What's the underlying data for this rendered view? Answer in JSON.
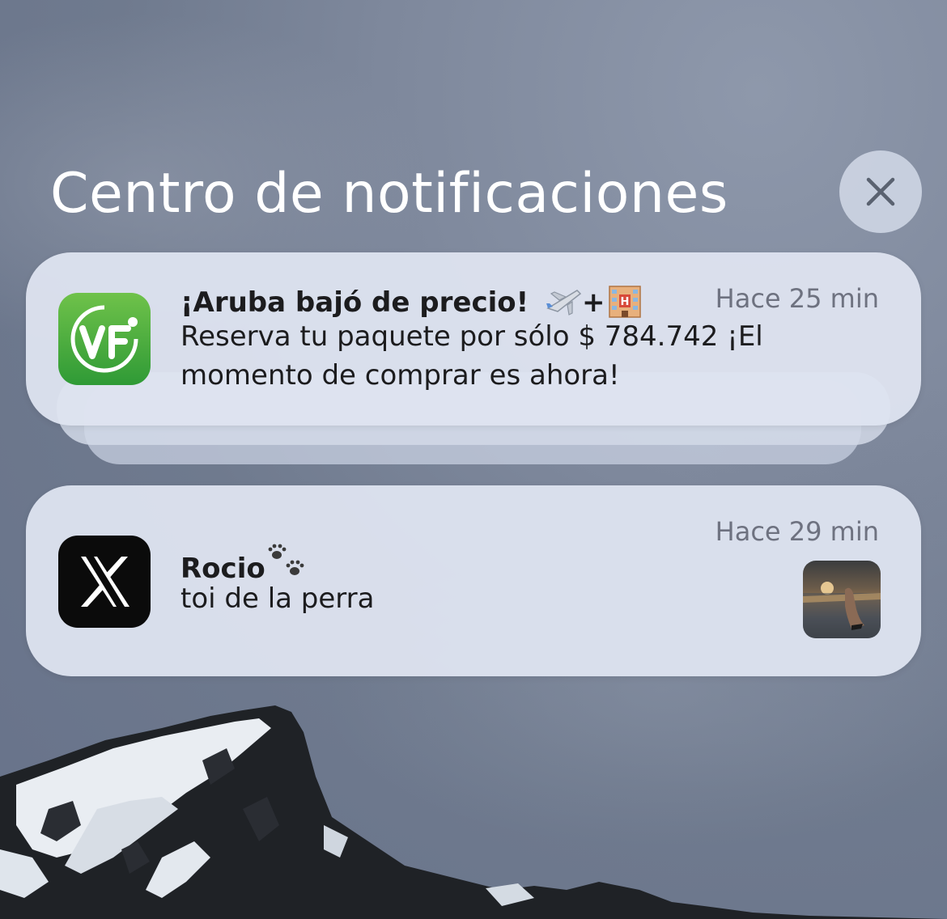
{
  "header": {
    "title": "Centro de notificaciones",
    "close_icon": "close-icon"
  },
  "notifications": [
    {
      "app_icon": "vf-app-icon",
      "app_icon_text": "VF",
      "title": "¡Aruba bajó de precio!",
      "title_emojis": [
        "airplane-emoji",
        "plus",
        "hotel-emoji"
      ],
      "plus_text": "+",
      "time": "Hace 25 min",
      "body": "Reserva tu paquete por sólo $ 784.742 ¡El momento de comprar es ahora!",
      "stacked": true
    },
    {
      "app_icon": "x-app-icon",
      "title": "Rocio",
      "title_emojis": [
        "paw-prints-emoji"
      ],
      "time": "Hace 29 min",
      "body": "toi de la perra",
      "attachment": "photo-thumbnail"
    }
  ],
  "colors": {
    "vf_green_top": "#6fc24a",
    "vf_green_bottom": "#2f9a36",
    "card_bg": "#dee4f0",
    "title_text": "#ffffff",
    "time_text": "#6e7280"
  }
}
